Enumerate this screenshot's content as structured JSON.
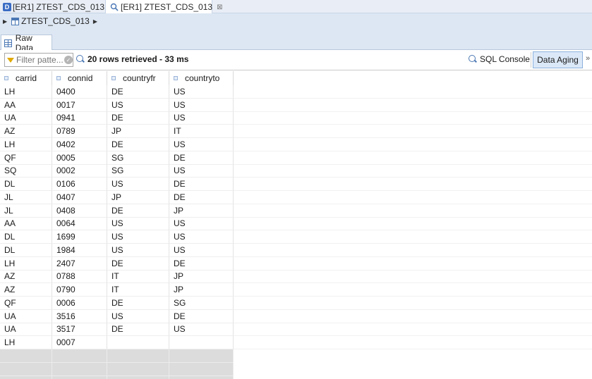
{
  "editor_tabs": [
    {
      "label": "[ER1] ZTEST_CDS_013",
      "active": false,
      "icon": "ddic-d-icon"
    },
    {
      "label": "[ER1] ZTEST_CDS_013",
      "active": true,
      "icon": "data-preview-icon",
      "close": "⊠"
    }
  ],
  "breadcrumb": {
    "label": "ZTEST_CDS_013"
  },
  "subtab": {
    "label": "Raw Data"
  },
  "toolbar": {
    "filter_placeholder": "Filter patte...",
    "rows_info": "20 rows retrieved - 33 ms",
    "sql_console_label": "SQL Console",
    "data_aging_label": "Data Aging"
  },
  "table": {
    "columns": [
      "carrid",
      "connid",
      "countryfr",
      "countryto"
    ],
    "rows": [
      [
        "LH",
        "0400",
        "DE",
        "US"
      ],
      [
        "AA",
        "0017",
        "US",
        "US"
      ],
      [
        "UA",
        "0941",
        "DE",
        "US"
      ],
      [
        "AZ",
        "0789",
        "JP",
        "IT"
      ],
      [
        "LH",
        "0402",
        "DE",
        "US"
      ],
      [
        "QF",
        "0005",
        "SG",
        "DE"
      ],
      [
        "SQ",
        "0002",
        "SG",
        "US"
      ],
      [
        "DL",
        "0106",
        "US",
        "DE"
      ],
      [
        "JL",
        "0407",
        "JP",
        "DE"
      ],
      [
        "JL",
        "0408",
        "DE",
        "JP"
      ],
      [
        "AA",
        "0064",
        "US",
        "US"
      ],
      [
        "DL",
        "1699",
        "US",
        "US"
      ],
      [
        "DL",
        "1984",
        "US",
        "US"
      ],
      [
        "LH",
        "2407",
        "DE",
        "DE"
      ],
      [
        "AZ",
        "0788",
        "IT",
        "JP"
      ],
      [
        "AZ",
        "0790",
        "IT",
        "JP"
      ],
      [
        "QF",
        "0006",
        "DE",
        "SG"
      ],
      [
        "UA",
        "3516",
        "US",
        "DE"
      ],
      [
        "UA",
        "3517",
        "DE",
        "US"
      ],
      [
        "LH",
        "0007",
        "",
        ""
      ]
    ],
    "empty_rows": 3
  },
  "colors": {
    "tab_strip": "#e9eef6",
    "panel": "#dde7f3",
    "accent": "#4a77b4",
    "data_aging_bg": "#dbe8f7",
    "empty_row": "#dcdcdc"
  }
}
